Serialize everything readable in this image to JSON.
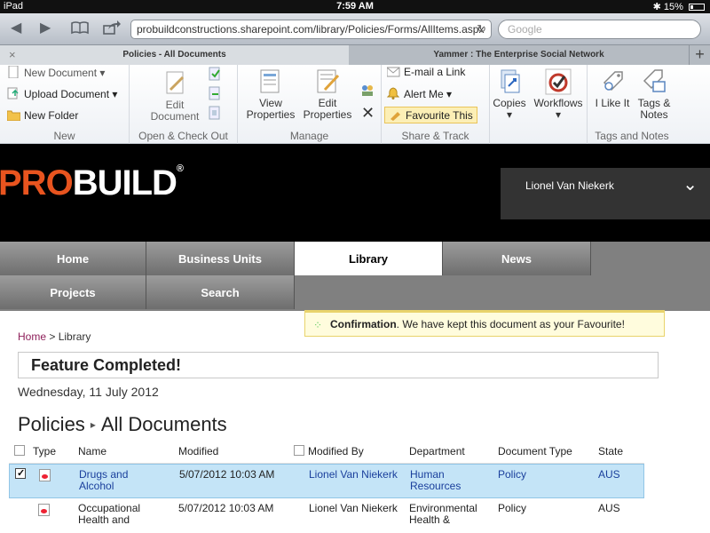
{
  "status": {
    "device": "iPad",
    "time": "7:59 AM",
    "battery": "15%",
    "bluetooth": "✱"
  },
  "browser": {
    "url": "probuildconstructions.sharepoint.com/library/Policies/Forms/AllItems.aspx",
    "search_placeholder": "Google",
    "tabs": [
      {
        "label": "Policies - All Documents",
        "active": true
      },
      {
        "label": "Yammer : The Enterprise Social Network",
        "active": false
      }
    ]
  },
  "ribbon": {
    "new": {
      "label": "New",
      "new_document": "New Document",
      "upload_document": "Upload Document",
      "new_folder": "New Folder"
    },
    "open_checkout": {
      "label": "Open & Check Out",
      "edit_document": "Edit Document"
    },
    "manage": {
      "label": "Manage",
      "view_properties": "View Properties",
      "edit_properties": "Edit Properties"
    },
    "share_track": {
      "label": "Share & Track",
      "email_link": "E-mail a Link",
      "alert_me": "Alert Me",
      "favourite": "Favourite This"
    },
    "copies": "Copies",
    "workflows": "Workflows",
    "tags_notes": {
      "label": "Tags and Notes",
      "i_like_it": "I Like It",
      "tags_notes_btn": "Tags & Notes"
    }
  },
  "header": {
    "logo_pro": "PRO",
    "logo_build": "BUILD",
    "logo_reg": "®",
    "user": "Lionel Van Niekerk"
  },
  "nav": {
    "items": [
      "Home",
      "Business Units",
      "Library",
      "News",
      "Projects",
      "Search"
    ],
    "active": "Library"
  },
  "confirmation": {
    "title": "Confirmation",
    "message": ". We have kept this document as your Favourite!"
  },
  "breadcrumb": {
    "home": "Home",
    "sep": " > ",
    "current": "Library"
  },
  "feature_title": "Feature Completed!",
  "date": "Wednesday, 11 July 2012",
  "page_title": {
    "list": "Policies",
    "sep": "▸",
    "view": "All Documents"
  },
  "columns": [
    "Type",
    "Name",
    "Modified",
    "Modified By",
    "Department",
    "Document Type",
    "State"
  ],
  "rows": [
    {
      "selected": true,
      "name_1": "Drugs and",
      "name_2": "Alcohol",
      "modified": "5/07/2012 10:03 AM",
      "modified_by": "Lionel Van Niekerk",
      "dept_1": "Human",
      "dept_2": "Resources",
      "doc_type": "Policy",
      "state": "AUS"
    },
    {
      "selected": false,
      "name_1": "Occupational",
      "name_2": "Health and",
      "modified": "5/07/2012 10:03 AM",
      "modified_by": "Lionel Van Niekerk",
      "dept_1": "Environmental",
      "dept_2": "Health &",
      "doc_type": "Policy",
      "state": "AUS"
    }
  ]
}
